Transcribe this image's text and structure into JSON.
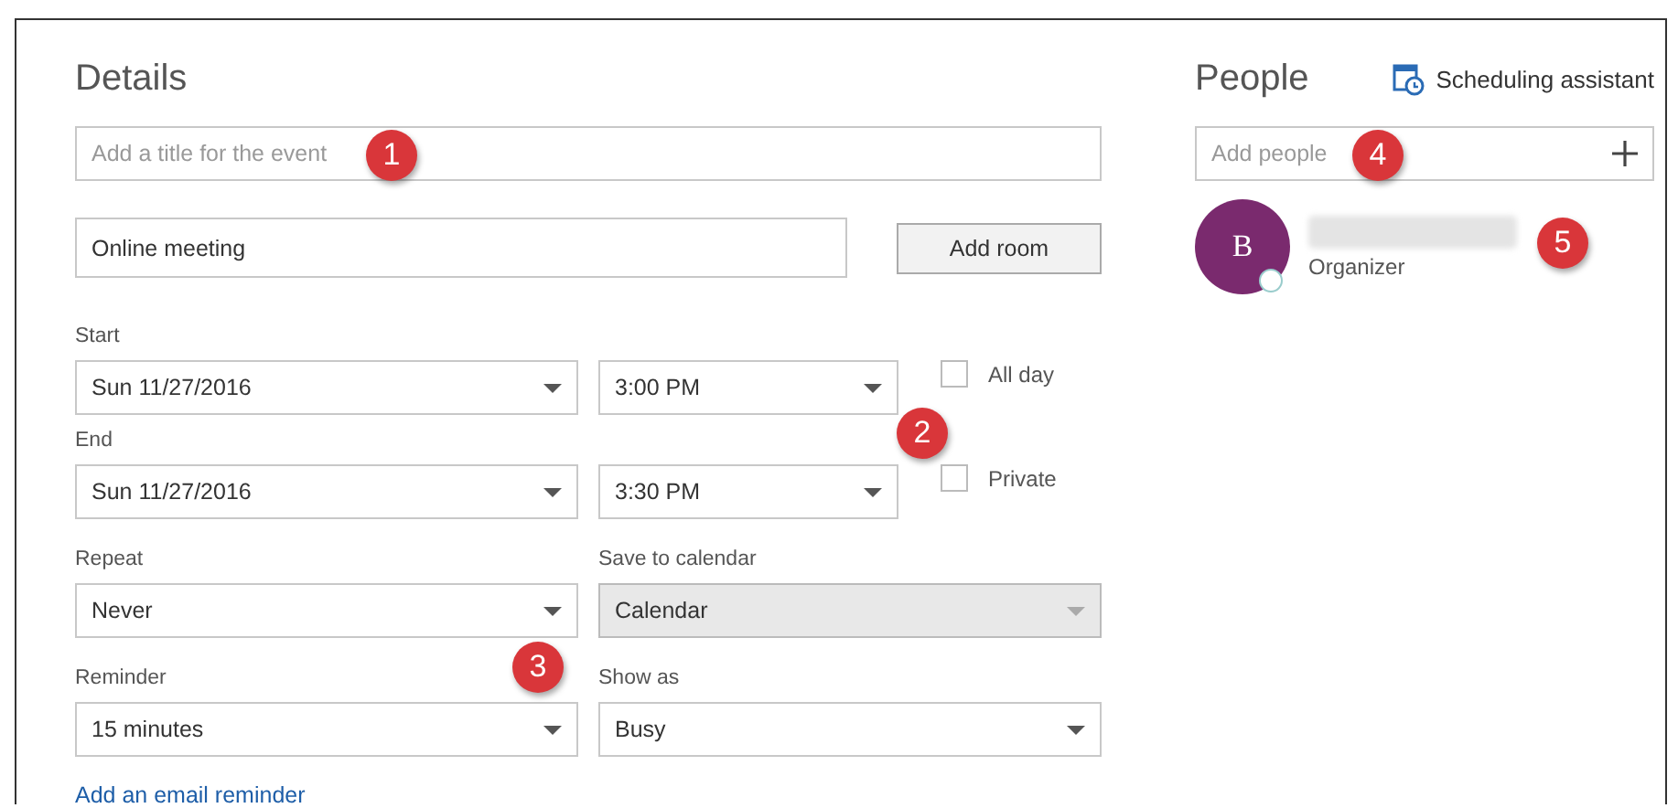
{
  "details": {
    "title": "Details",
    "event_title": {
      "placeholder": "Add a title for the event"
    },
    "location": {
      "value": "Online meeting"
    },
    "add_room_button": "Add room",
    "start": {
      "label": "Start",
      "date": "Sun 11/27/2016",
      "time": "3:00 PM"
    },
    "end": {
      "label": "End",
      "date": "Sun 11/27/2016",
      "time": "3:30 PM"
    },
    "all_day": {
      "label": "All day",
      "checked": false
    },
    "private": {
      "label": "Private",
      "checked": false
    },
    "repeat": {
      "label": "Repeat",
      "value": "Never",
      "disabled": false
    },
    "save_to_calendar": {
      "label": "Save to calendar",
      "value": "Calendar",
      "disabled": true
    },
    "reminder": {
      "label": "Reminder",
      "value": "15 minutes",
      "disabled": false
    },
    "show_as": {
      "label": "Show as",
      "value": "Busy",
      "disabled": false
    },
    "email_reminder_link": "Add an email reminder"
  },
  "people": {
    "title": "People",
    "scheduling_assistant": "Scheduling assistant",
    "add_people": {
      "placeholder": "Add people"
    },
    "attendees": [
      {
        "initial": "B",
        "role": "Organizer",
        "color": "#7a2a6e"
      }
    ]
  },
  "callouts": [
    "1",
    "2",
    "3",
    "4",
    "5"
  ]
}
